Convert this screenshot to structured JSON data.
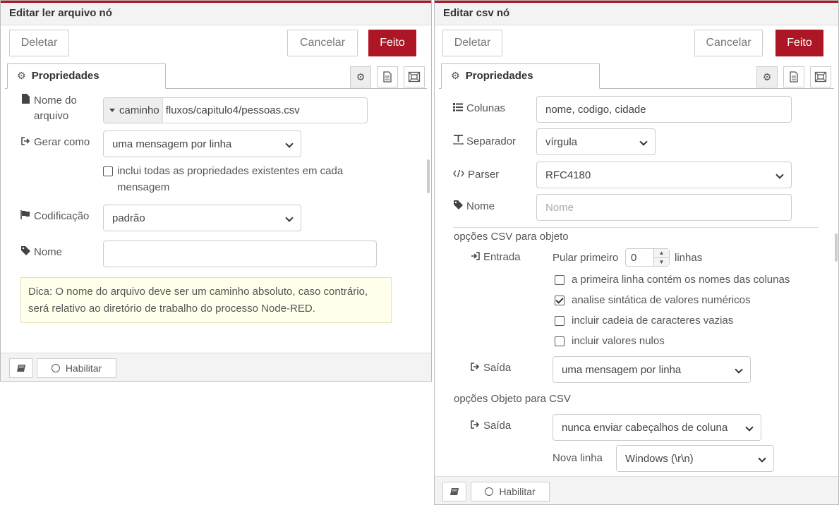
{
  "left_panel": {
    "title": "Editar ler arquivo nó",
    "delete_label": "Deletar",
    "cancel_label": "Cancelar",
    "done_label": "Feito",
    "tab_label": "Propriedades",
    "filename_label": "Nome do arquivo",
    "filename_type": "caminho",
    "filename_value": "fluxos/capitulo4/pessoas.csv",
    "output_label": "Gerar como",
    "output_value": "uma mensagem por linha",
    "include_props_label": "inclui todas as propriedades existentes em cada mensagem",
    "include_props_checked": false,
    "encoding_label": "Codificação",
    "encoding_value": "padrão",
    "name_label": "Nome",
    "name_value": "",
    "tip": "Dica: O nome do arquivo deve ser um caminho absoluto, caso contrário, será relativo ao diretório de trabalho do processo Node-RED.",
    "enable_label": "Habilitar"
  },
  "right_panel": {
    "title": "Editar csv nó",
    "delete_label": "Deletar",
    "cancel_label": "Cancelar",
    "done_label": "Feito",
    "tab_label": "Propriedades",
    "columns_label": "Colunas",
    "columns_value": "nome, codigo, cidade",
    "separator_label": "Separador",
    "separator_value": "vírgula",
    "parser_label": "Parser",
    "parser_value": "RFC4180",
    "name_label": "Nome",
    "name_placeholder": "Nome",
    "csv_to_obj_heading": "opções CSV para objeto",
    "input_label": "Entrada",
    "skip_first_label": "Pular primeiro",
    "skip_first_value": "0",
    "lines_label": "linhas",
    "first_row_names_label": "a primeira linha contém os nomes das colunas",
    "first_row_names_checked": false,
    "parse_numbers_label": "analise sintática de valores numéricos",
    "parse_numbers_checked": true,
    "include_empty_label": "incluir cadeia de caracteres vazias",
    "include_empty_checked": false,
    "include_null_label": "incluir valores nulos",
    "include_null_checked": false,
    "output_label": "Saída",
    "output_value": "uma mensagem por linha",
    "obj_to_csv_heading": "opções Objeto para CSV",
    "output2_label": "Saída",
    "output2_value": "nunca enviar cabeçalhos de coluna",
    "newline_label": "Nova linha",
    "newline_value": "Windows (\\r\\n)",
    "enable_label": "Habilitar"
  },
  "colors": {
    "accent": "#ad1625",
    "tip_background": "#ffffec"
  }
}
